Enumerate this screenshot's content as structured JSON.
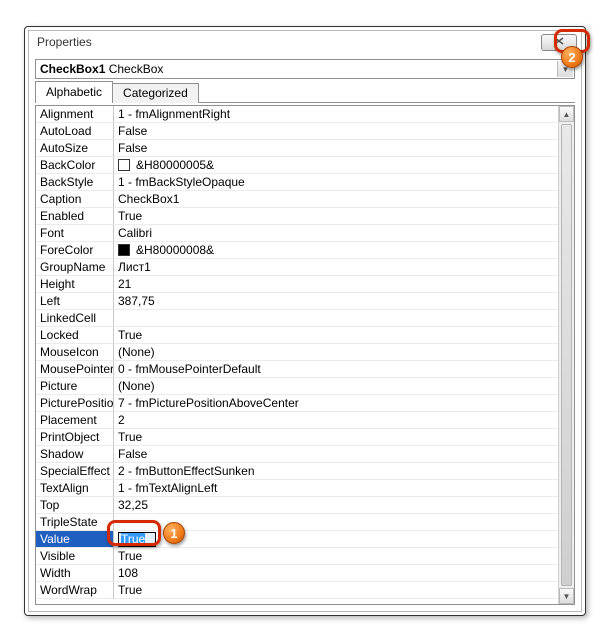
{
  "window": {
    "title": "Properties",
    "close_icon_name": "close-icon"
  },
  "object_selector": {
    "name_bold": "CheckBox1",
    "type": "CheckBox"
  },
  "tabs": {
    "alphabetic": "Alphabetic",
    "categorized": "Categorized",
    "active": "alphabetic"
  },
  "selected_property": "Value",
  "edit_value": "True",
  "properties": [
    {
      "name": "Alignment",
      "value": "1 - fmAlignmentRight"
    },
    {
      "name": "AutoLoad",
      "value": "False"
    },
    {
      "name": "AutoSize",
      "value": "False"
    },
    {
      "name": "BackColor",
      "value": "&H80000005&",
      "swatch": "#ffffff"
    },
    {
      "name": "BackStyle",
      "value": "1 - fmBackStyleOpaque"
    },
    {
      "name": "Caption",
      "value": "CheckBox1"
    },
    {
      "name": "Enabled",
      "value": "True"
    },
    {
      "name": "Font",
      "value": "Calibri"
    },
    {
      "name": "ForeColor",
      "value": "&H80000008&",
      "swatch": "#000000"
    },
    {
      "name": "GroupName",
      "value": "Лист1"
    },
    {
      "name": "Height",
      "value": "21"
    },
    {
      "name": "Left",
      "value": "387,75"
    },
    {
      "name": "LinkedCell",
      "value": ""
    },
    {
      "name": "Locked",
      "value": "True"
    },
    {
      "name": "MouseIcon",
      "value": "(None)"
    },
    {
      "name": "MousePointer",
      "value": "0 - fmMousePointerDefault"
    },
    {
      "name": "Picture",
      "value": "(None)"
    },
    {
      "name": "PicturePosition",
      "value": "7 - fmPicturePositionAboveCenter"
    },
    {
      "name": "Placement",
      "value": "2"
    },
    {
      "name": "PrintObject",
      "value": "True"
    },
    {
      "name": "Shadow",
      "value": "False"
    },
    {
      "name": "SpecialEffect",
      "value": "2 - fmButtonEffectSunken"
    },
    {
      "name": "TextAlign",
      "value": "1 - fmTextAlignLeft"
    },
    {
      "name": "Top",
      "value": "32,25"
    },
    {
      "name": "TripleState",
      "value": ""
    },
    {
      "name": "Value",
      "value": "True"
    },
    {
      "name": "Visible",
      "value": "True"
    },
    {
      "name": "Width",
      "value": "108"
    },
    {
      "name": "WordWrap",
      "value": "True"
    }
  ],
  "callouts": {
    "badge1": "1",
    "badge2": "2"
  }
}
